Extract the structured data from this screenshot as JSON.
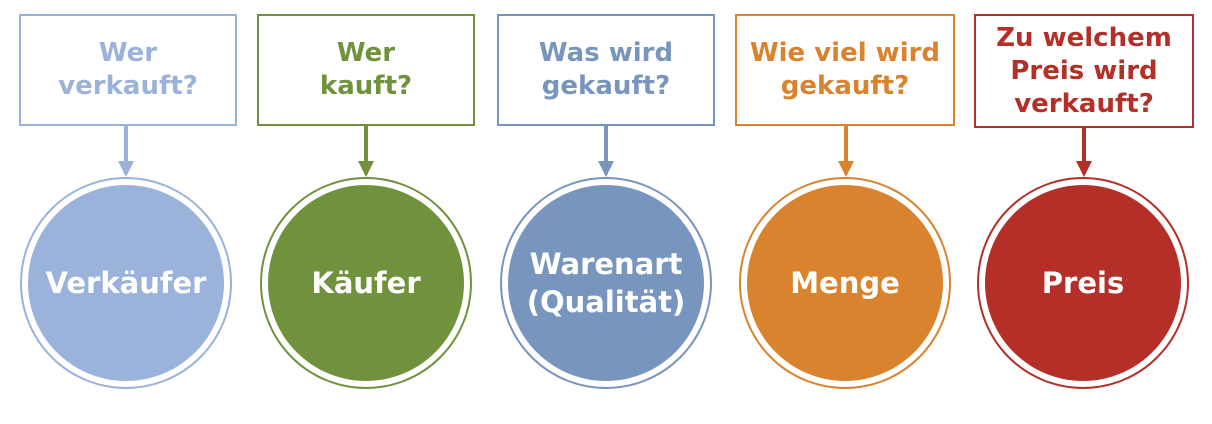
{
  "items": [
    {
      "question": "Wer\nverkauft?",
      "label": "Verkäufer",
      "color": "#9bb2da",
      "text_color": "#9bb2da"
    },
    {
      "question": "Wer\nkauft?",
      "label": "Käufer",
      "color": "#70923c",
      "text_color": "#70923c"
    },
    {
      "question": "Was wird\ngekauft?",
      "label": "Warenart\n(Qualität)",
      "color": "#7895bd",
      "text_color": "#7895bd"
    },
    {
      "question": "Wie viel wird\ngekauft?",
      "label": "Menge",
      "color": "#d9832e",
      "text_color": "#d9832e"
    },
    {
      "question": "Zu welchem\nPreis wird\nverkauft?",
      "label": "Preis",
      "color": "#b42f27",
      "text_color": "#b42f27"
    }
  ]
}
